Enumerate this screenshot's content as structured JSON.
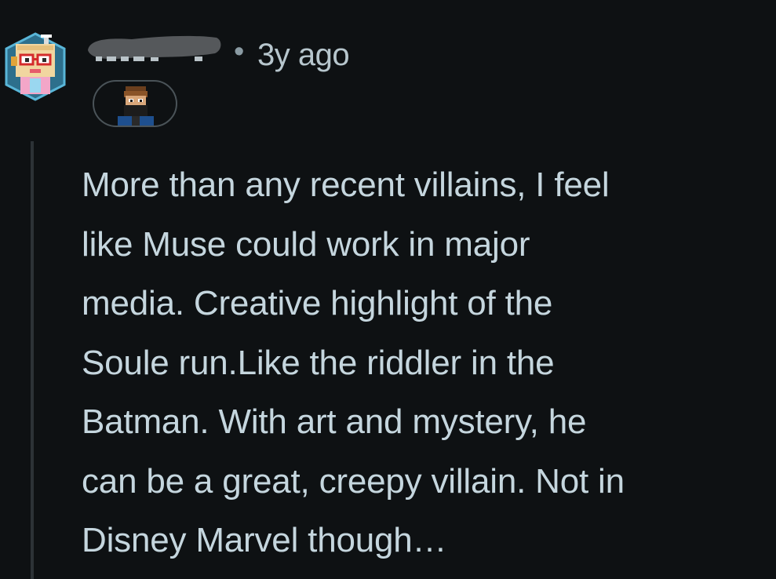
{
  "comment": {
    "author": {
      "username_redacted": true,
      "avatar_icon": "pixel-robot-avatar-icon",
      "flair_icon": "pixel-masked-character-icon"
    },
    "separator": "•",
    "timestamp": "3y ago",
    "body": "More than any recent villains, I feel\nlike Muse could work in major\nmedia. Creative highlight of the\nSoule run.Like the riddler in the\nBatman. With art and mystery, he\ncan be a great, creepy villain. Not in\nDisney Marvel though…"
  },
  "colors": {
    "background": "#0e1113",
    "body_text": "#c5d6de",
    "meta_text": "#b7c6cd",
    "thread_line": "#2c3236",
    "redaction": "#55585b"
  }
}
